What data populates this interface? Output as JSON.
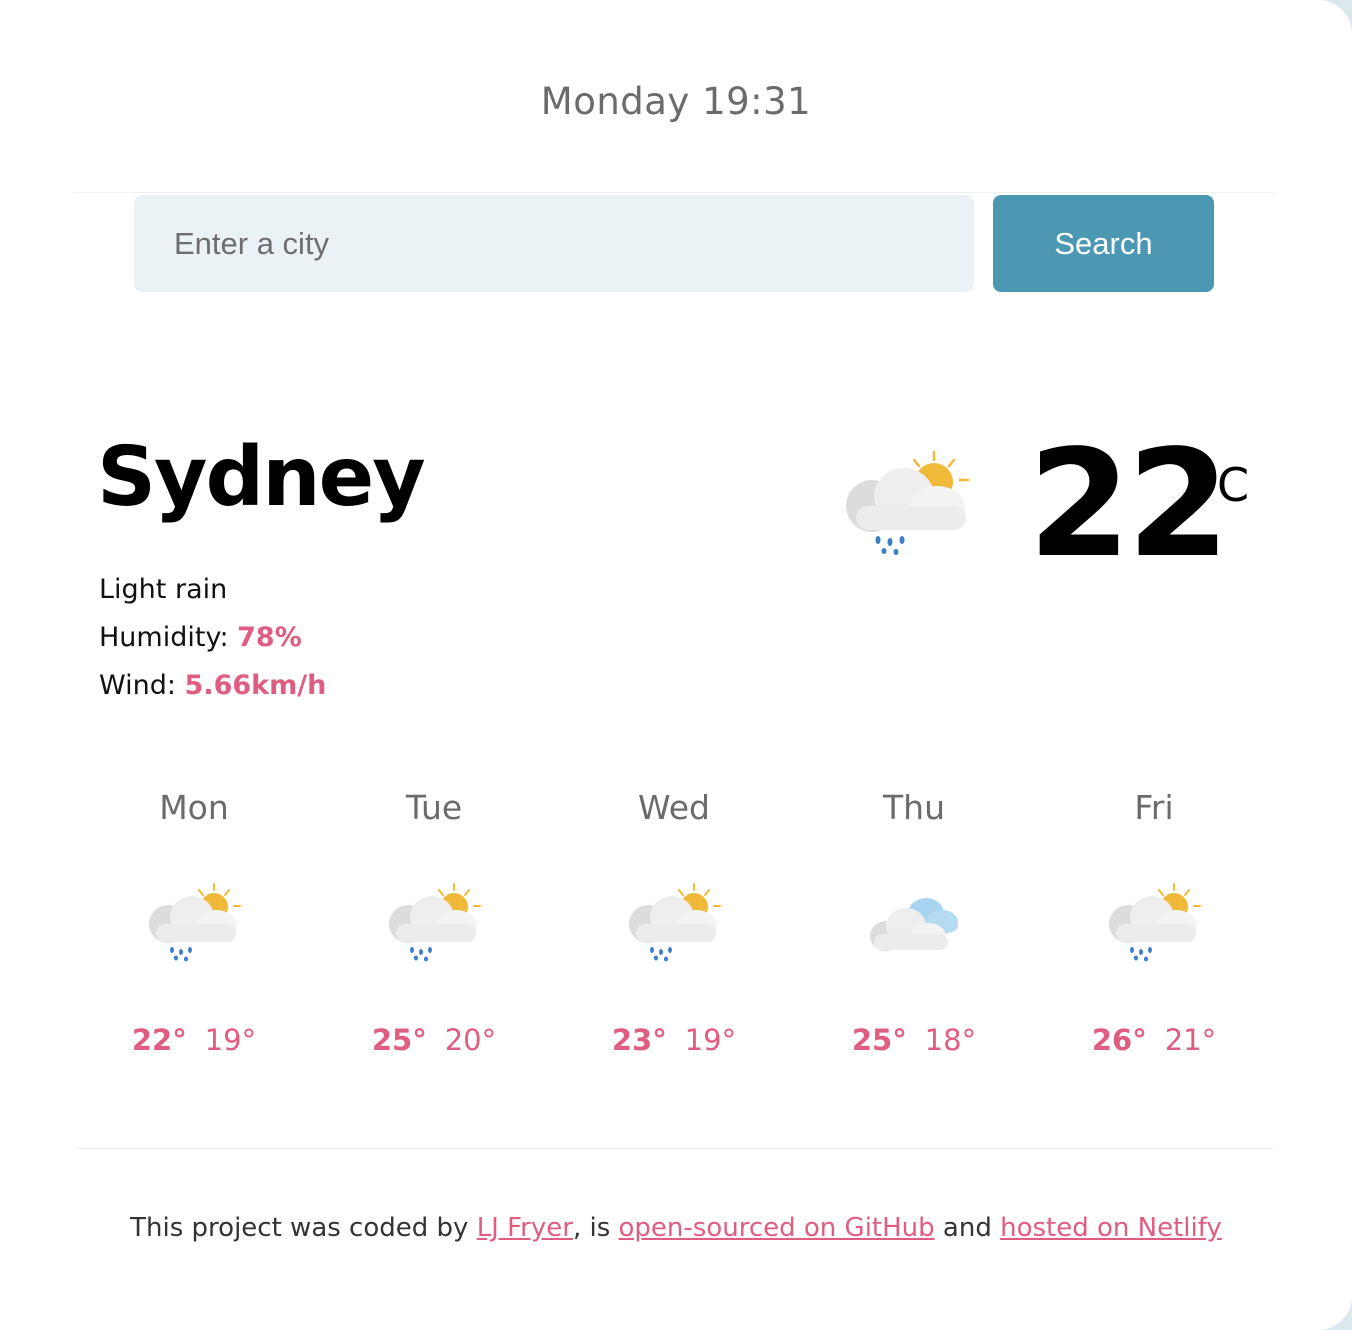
{
  "header": {
    "datetime": "Monday 19:31"
  },
  "search": {
    "placeholder": "Enter a city",
    "button_label": "Search"
  },
  "current": {
    "city": "Sydney",
    "description": "Light rain",
    "humidity_label": "Humidity: ",
    "humidity_value": "78%",
    "wind_label": "Wind: ",
    "wind_value": "5.66km/h",
    "temperature": "22",
    "unit": "°C",
    "icon": "sun-cloud-rain-icon"
  },
  "forecast": [
    {
      "day": "Mon",
      "max": "22°",
      "min": "19°",
      "icon": "sun-cloud-rain-icon"
    },
    {
      "day": "Tue",
      "max": "25°",
      "min": "20°",
      "icon": "sun-cloud-rain-icon"
    },
    {
      "day": "Wed",
      "max": "23°",
      "min": "19°",
      "icon": "sun-cloud-rain-icon"
    },
    {
      "day": "Thu",
      "max": "25°",
      "min": "18°",
      "icon": "cloudy-icon"
    },
    {
      "day": "Fri",
      "max": "26°",
      "min": "21°",
      "icon": "sun-cloud-rain-icon"
    }
  ],
  "footer": {
    "prefix": "This project was coded by ",
    "author_link": "LJ Fryer",
    "middle": ", is ",
    "github_link": "open-sourced on GitHub",
    "and": " and ",
    "netlify_link": "hosted on Netlify"
  },
  "colors": {
    "accent": "#e05d82",
    "button": "#4c97b2",
    "input_bg": "#ebf2f5",
    "sun": "#f0b93a",
    "rain": "#3b7fc4",
    "cloud_blue": "#a8d4f0"
  }
}
